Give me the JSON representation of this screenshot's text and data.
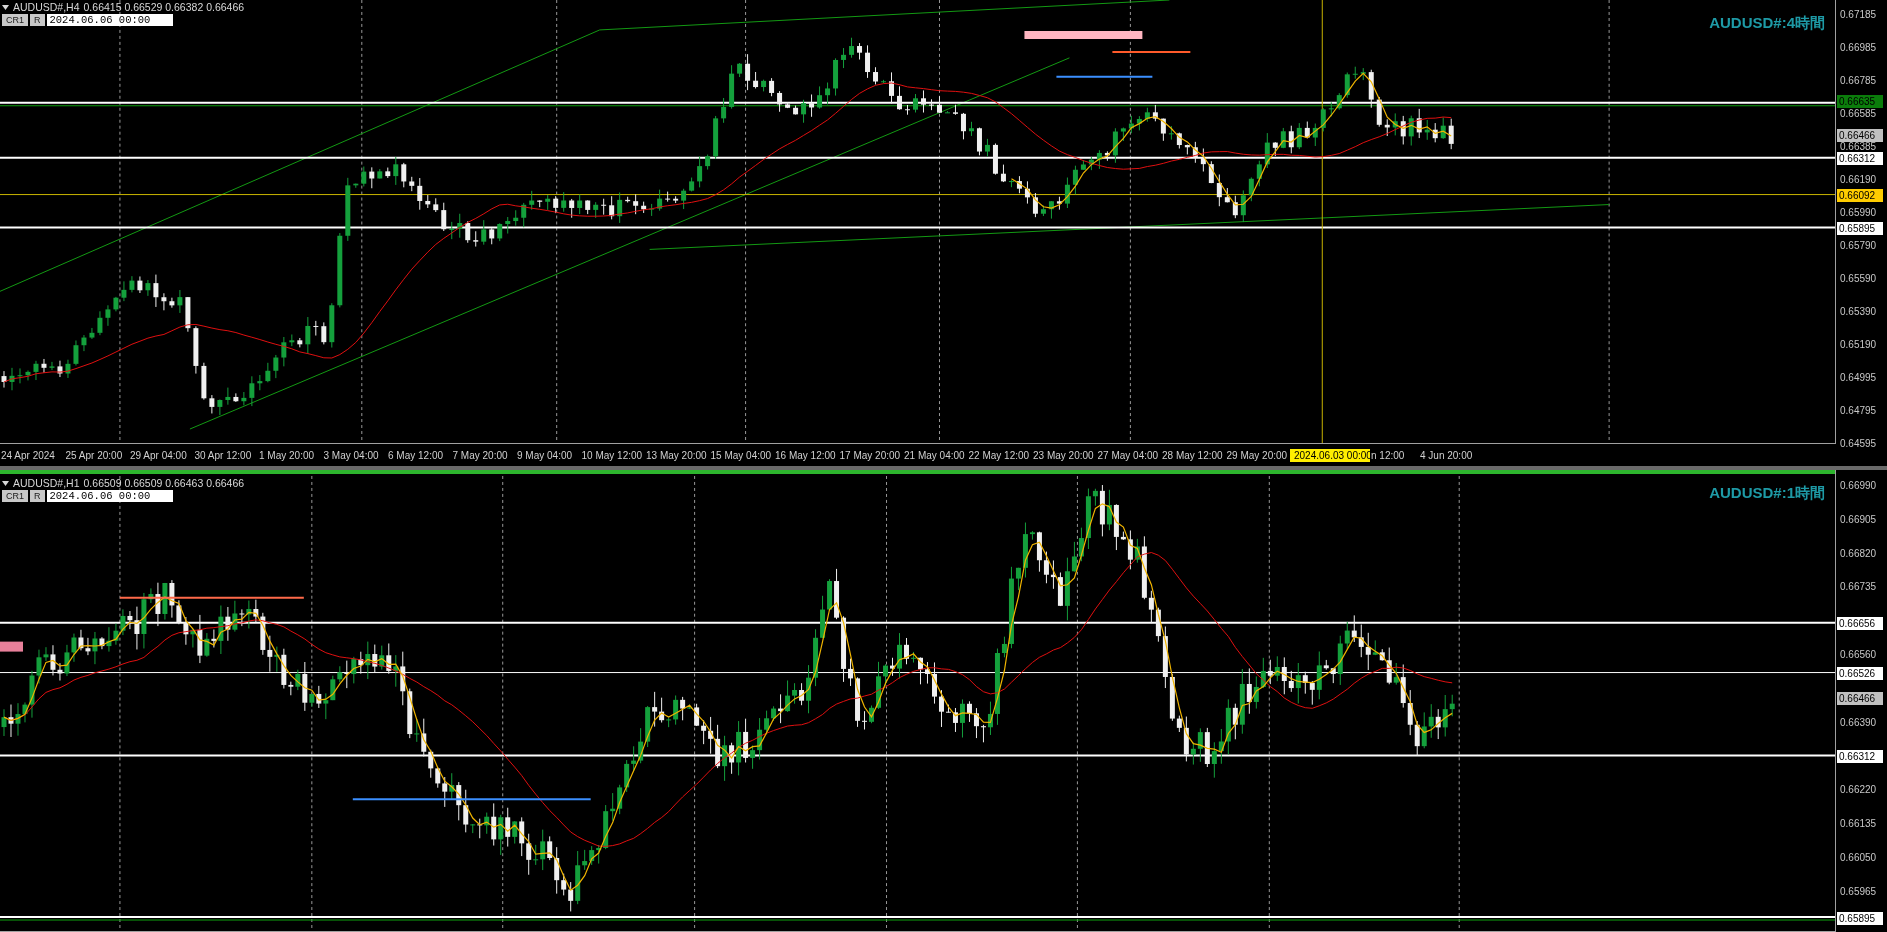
{
  "panes": [
    {
      "symbol": "AUDUSD#,H4",
      "ohlc": "0.66415 0.66529 0.66382 0.66466",
      "buttons": [
        "CR1",
        "R"
      ],
      "date_value": "2024.06.06 00:00",
      "title": "AUDUSD#:4時間",
      "price_ticks": [
        "0.67185",
        "0.66985",
        "0.66785",
        "0.66585",
        "0.66385",
        "0.66190",
        "0.65990",
        "0.65790",
        "0.65590",
        "0.65390",
        "0.65190",
        "0.64995",
        "0.64795",
        "0.64595"
      ],
      "price_tags": [
        {
          "text": "0.66635",
          "color": "#0b7d0b"
        },
        {
          "text": "0.66466",
          "color": "#c0c0c0"
        },
        {
          "text": "0.66312",
          "color": "#ffffff"
        },
        {
          "text": "0.66092",
          "color": "#ffcc00"
        },
        {
          "text": "0.65895",
          "color": "#ffffff"
        }
      ],
      "time_labels": [
        {
          "text": "24 Apr 2024",
          "kind": "tick"
        },
        {
          "text": "25 Apr 20:00",
          "kind": "tick"
        },
        {
          "text": "29 Apr 04:00",
          "kind": "tick"
        },
        {
          "text": "30 Apr 12:00",
          "kind": "tick"
        },
        {
          "text": "1 May 20:00",
          "kind": "tick"
        },
        {
          "text": "3 May 04:00",
          "kind": "tick"
        },
        {
          "text": "6 May 12:00",
          "kind": "tick"
        },
        {
          "text": "7 May 20:00",
          "kind": "tick"
        },
        {
          "text": "9 May 04:00",
          "kind": "tick"
        },
        {
          "text": "10 May 12:00",
          "kind": "tick"
        },
        {
          "text": "13 May 20:00",
          "kind": "tick"
        },
        {
          "text": "15 May 04:00",
          "kind": "tick"
        },
        {
          "text": "16 May 12:00",
          "kind": "tick"
        },
        {
          "text": "17 May 20:00",
          "kind": "tick"
        },
        {
          "text": "21 May 04:00",
          "kind": "tick"
        },
        {
          "text": "22 May 12:00",
          "kind": "tick"
        },
        {
          "text": "23 May 20:00",
          "kind": "tick"
        },
        {
          "text": "27 May 04:00",
          "kind": "tick"
        },
        {
          "text": "28 May 12:00",
          "kind": "tick"
        },
        {
          "text": "29 May 20:00",
          "kind": "tick"
        },
        {
          "text": "2024.06.03 00:00",
          "kind": "highlight"
        },
        {
          "text": "n 12:00",
          "kind": "partial"
        },
        {
          "text": "4 Jun 20:00",
          "kind": "tick"
        }
      ]
    },
    {
      "symbol": "AUDUSD#,H1",
      "ohlc": "0.66509 0.66509 0.66463 0.66466",
      "buttons": [
        "CR1",
        "R"
      ],
      "date_value": "2024.06.06 00:00",
      "title": "AUDUSD#:1時間",
      "price_ticks": [
        "0.66990",
        "0.66905",
        "0.66820",
        "0.66735",
        "0.66560",
        "0.66390",
        "0.66220",
        "0.66135",
        "0.66050",
        "0.65965"
      ],
      "price_tags": [
        {
          "text": "0.66656",
          "color": "#ffffff"
        },
        {
          "text": "0.66526",
          "color": "#ffffff"
        },
        {
          "text": "0.66466",
          "color": "#c0c0c0"
        },
        {
          "text": "0.66312",
          "color": "#ffffff"
        },
        {
          "text": "0.65895",
          "color": "#ffffff"
        }
      ]
    }
  ]
}
